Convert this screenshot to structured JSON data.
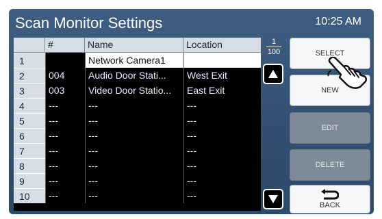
{
  "header": {
    "title": "Scan Monitor Settings",
    "time": "10:25 AM"
  },
  "table": {
    "columns": [
      "#",
      "Name",
      "Location"
    ],
    "rows": [
      {
        "index": "1",
        "number": "",
        "name": "Network Camera1",
        "location": ""
      },
      {
        "index": "2",
        "number": "004",
        "name": "Audio Door Stati...",
        "location": "West Exit"
      },
      {
        "index": "3",
        "number": "003",
        "name": "Video Door Statio...",
        "location": "East Exit"
      },
      {
        "index": "4",
        "number": "---",
        "name": "---",
        "location": "---"
      },
      {
        "index": "5",
        "number": "---",
        "name": "---",
        "location": "---"
      },
      {
        "index": "6",
        "number": "---",
        "name": "---",
        "location": "---"
      },
      {
        "index": "7",
        "number": "---",
        "name": "---",
        "location": "---"
      },
      {
        "index": "8",
        "number": "---",
        "name": "---",
        "location": "---"
      },
      {
        "index": "9",
        "number": "---",
        "name": "---",
        "location": "---"
      },
      {
        "index": "10",
        "number": "---",
        "name": "---",
        "location": "---"
      }
    ]
  },
  "pager": {
    "current": "1",
    "total": "100"
  },
  "buttons": {
    "select": "SELECT",
    "new": "NEW",
    "edit": "EDIT",
    "delete": "DELETE",
    "back": "BACK"
  },
  "icons": {
    "scroll_up": "triangle-up-icon",
    "scroll_down": "triangle-down-icon",
    "back": "return-arrow-icon",
    "pointer": "hand-pointer-icon"
  },
  "colors": {
    "panel": "#3a5a7e",
    "selected_row": "#ffffff",
    "disabled_button": "#7e8a97"
  }
}
